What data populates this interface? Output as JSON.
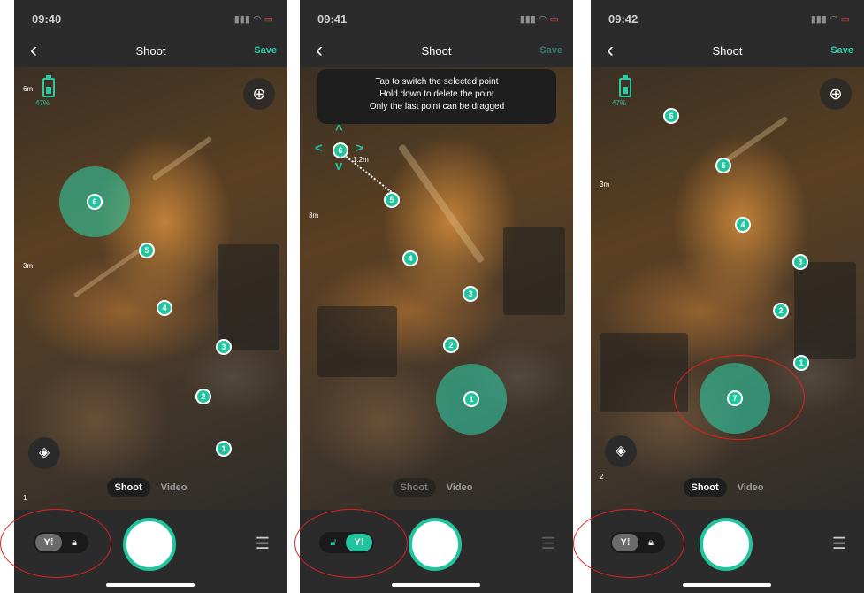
{
  "screens": [
    {
      "time": "09:40",
      "title": "Shoot",
      "save_label": "Save",
      "battery_pct": "47%",
      "scale_top": "6m",
      "scale_mid": "3m",
      "scale_bottom": "1",
      "mode_shoot": "Shoot",
      "mode_video": "Video",
      "waypoints": [
        "6",
        "5",
        "4",
        "3",
        "2",
        "1"
      ]
    },
    {
      "time": "09:41",
      "title": "Shoot",
      "save_label": "Save",
      "tooltip_line1": "Tap to switch the selected point",
      "tooltip_line2": "Hold down to delete the point",
      "tooltip_line3": "Only the last point can be dragged",
      "distance": "1.2m",
      "scale_mid": "3m",
      "mode_shoot": "Shoot",
      "mode_video": "Video",
      "waypoints": [
        "6",
        "5",
        "4",
        "3",
        "2",
        "1"
      ]
    },
    {
      "time": "09:42",
      "title": "Shoot",
      "save_label": "Save",
      "battery_pct": "47%",
      "scale_mid": "3m",
      "scale_bottom": "2",
      "mode_shoot": "Shoot",
      "mode_video": "Video",
      "waypoints": [
        "6",
        "5",
        "4",
        "3",
        "2",
        "1",
        "7"
      ]
    }
  ],
  "icons": {
    "back": "chevron-left-icon",
    "target": "crosshair-icon",
    "layers": "layers-icon",
    "lock": "lock-icon",
    "unlock": "unlock-icon",
    "drone": "drone-icon",
    "settings": "sliders-icon"
  },
  "colors": {
    "accent": "#22c49d",
    "annotation": "#e02020",
    "background": "#2b2b2b"
  }
}
